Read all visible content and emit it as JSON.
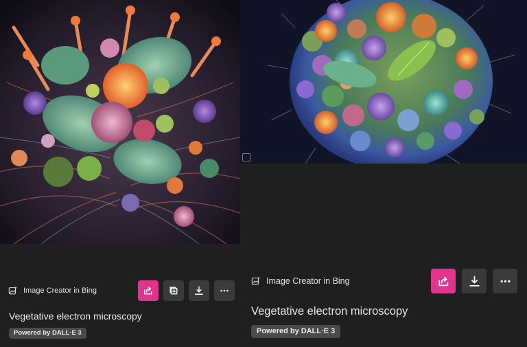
{
  "cards": [
    {
      "source_label": "Image Creator in Bing",
      "source_icon": "image-creator-icon",
      "actions": [
        "share-icon",
        "add-to-collection-icon",
        "download-icon",
        "more-icon"
      ],
      "title": "Vegetative electron microscopy",
      "badge": "Powered by DALL·E 3"
    },
    {
      "source_label": "Image Creator in Bing",
      "source_icon": "image-creator-icon",
      "actions": [
        "share-icon",
        "download-icon",
        "more-icon"
      ],
      "title": "Vegetative electron microscopy",
      "badge": "Powered by DALL·E 3"
    }
  ],
  "colors": {
    "background": "#1f1f1f",
    "share_accent": "#e0348f",
    "button_bg": "#3a3a3a",
    "badge_bg": "#4a4a4a"
  }
}
